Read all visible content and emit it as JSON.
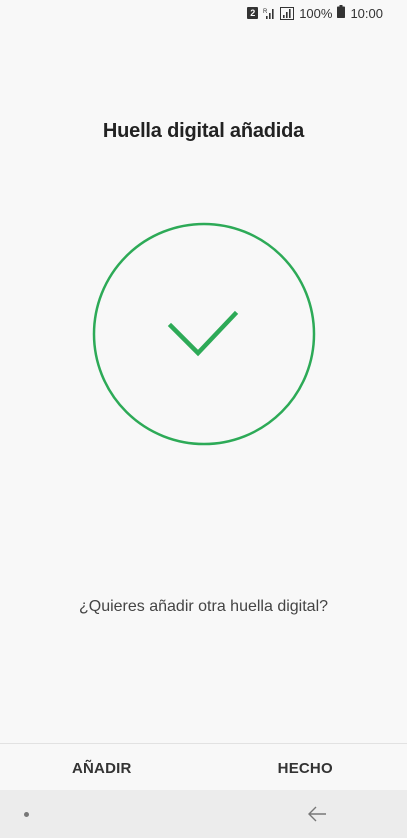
{
  "status_bar": {
    "sim_slot": "2",
    "battery_percent": "100%",
    "time": "10:00",
    "icons": [
      "sim-2-icon",
      "signal-icon",
      "signal-icon",
      "battery-icon"
    ]
  },
  "title": "Huella digital añadida",
  "status_icon": "checkmark-circle-icon",
  "accent_color": "#2daa57",
  "question": "¿Quieres añadir otra huella digital?",
  "actions": {
    "add_label": "AÑADIR",
    "done_label": "HECHO"
  },
  "navigation": {
    "icons": [
      "recent-apps-dot-icon",
      "back-arrow-icon"
    ]
  }
}
